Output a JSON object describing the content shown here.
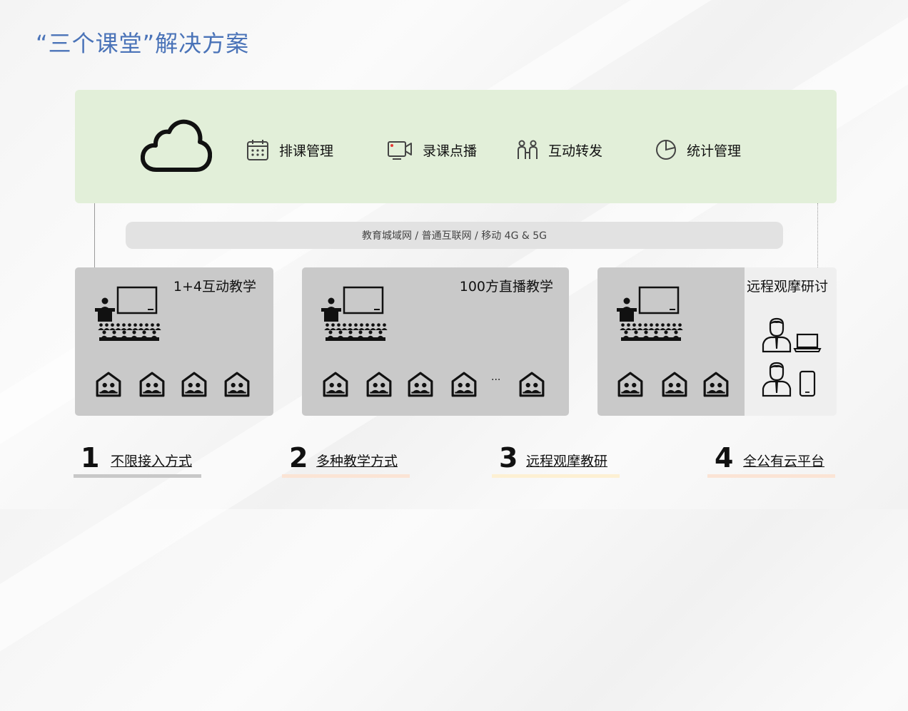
{
  "title": "“三个课堂”解决方案",
  "platform": {
    "features": [
      {
        "label": "排课管理",
        "icon": "calendar-icon"
      },
      {
        "label": "录课点播",
        "icon": "video-camera-icon"
      },
      {
        "label": "互动转发",
        "icon": "people-icon"
      },
      {
        "label": "统计管理",
        "icon": "pie-chart-icon"
      }
    ],
    "colors": {
      "panel": "#e2efd9"
    }
  },
  "network": {
    "label": "教育城域网 / 普通互联网 / 移动 4G & 5G"
  },
  "panels": [
    {
      "title": "1+4互动教学",
      "classroom_count": 4
    },
    {
      "title": "100方直播教学",
      "classroom_count": 5,
      "ellipsis": "···"
    },
    {
      "title": "远程观摩研讨",
      "classroom_count": 3
    }
  ],
  "bottom": [
    {
      "num": "1",
      "label": "不限接入方式",
      "bar_color": "#c8c8c8"
    },
    {
      "num": "2",
      "label": "多种教学方式",
      "bar_color": "#fbe4d5"
    },
    {
      "num": "3",
      "label": "远程观摩教研",
      "bar_color": "#fdf0d3"
    },
    {
      "num": "4",
      "label": "全公有云平台",
      "bar_color": "#fbe4d5"
    }
  ],
  "colors": {
    "title": "#4a73b8",
    "panel_gray": "#c9c9c9"
  }
}
